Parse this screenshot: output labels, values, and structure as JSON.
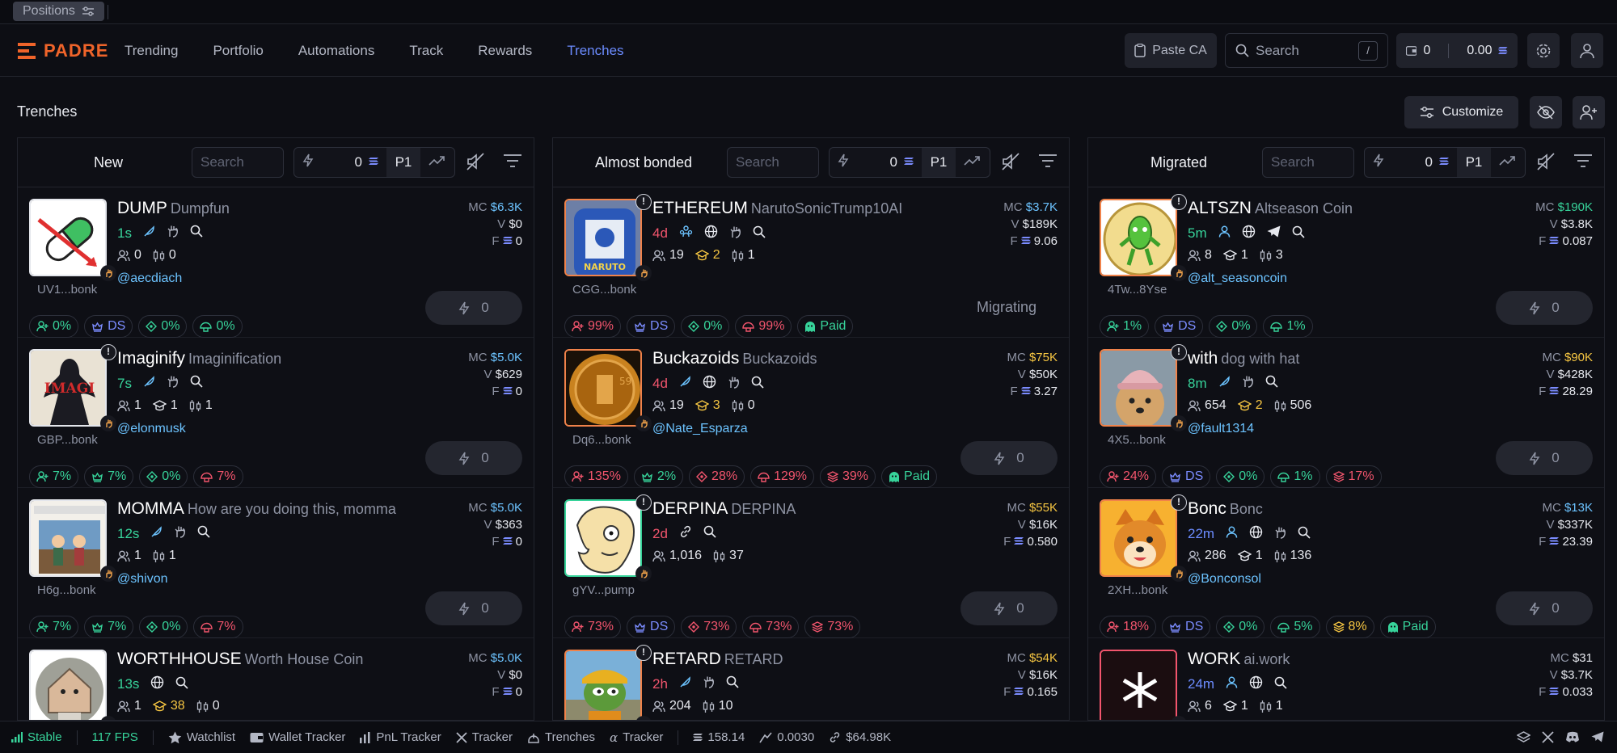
{
  "topstrip": {
    "positions_label": "Positions"
  },
  "nav": {
    "logo": "PADRE",
    "links": [
      "Trending",
      "Portfolio",
      "Automations",
      "Track",
      "Rewards",
      "Trenches"
    ],
    "paste_ca": "Paste CA",
    "search_placeholder": "Search",
    "search_kbd": "/",
    "wallet_count": "0",
    "wallet_balance": "0.00"
  },
  "page": {
    "title": "Trenches",
    "customize": "Customize"
  },
  "columns": [
    {
      "name": "New",
      "search_placeholder": "Search",
      "quick_amount": "0",
      "preset": "P1",
      "cards": [
        {
          "name": "DUMP",
          "sub": "Dumpfun",
          "age": "1s",
          "age_color": "#37d39a",
          "ca": "UV1...bonk",
          "handle": "@aecdiach",
          "mc": "$6.3K",
          "mc_color": "#6cc3ff",
          "v": "$0",
          "f": "0",
          "holders": "0",
          "h2": null,
          "h2c": "w",
          "h3": "0",
          "btn": "0",
          "pills": [
            {
              "t": "0%",
              "c": "g",
              "i": "user"
            },
            {
              "t": "DS",
              "c": "b",
              "i": "hat"
            },
            {
              "t": "0%",
              "c": "g",
              "i": "target"
            },
            {
              "t": "0%",
              "c": "g",
              "i": "mush"
            }
          ],
          "img": "dump",
          "excl": false
        },
        {
          "name": "Imaginify",
          "sub": "Imaginification",
          "age": "7s",
          "age_color": "#37d39a",
          "ca": "GBP...bonk",
          "handle": "@elonmusk",
          "mc": "$5.0K",
          "mc_color": "#6cc3ff",
          "v": "$629",
          "f": "0",
          "holders": "1",
          "h2": "1",
          "h2c": "w",
          "h3": "1",
          "btn": "0",
          "pills": [
            {
              "t": "7%",
              "c": "g",
              "i": "user"
            },
            {
              "t": "7%",
              "c": "g",
              "i": "hat"
            },
            {
              "t": "0%",
              "c": "g",
              "i": "target"
            },
            {
              "t": "7%",
              "c": "r",
              "i": "mush"
            }
          ],
          "img": "imag",
          "excl": true
        },
        {
          "name": "MOMMA",
          "sub": "How are you doing this, momma",
          "age": "12s",
          "age_color": "#37d39a",
          "ca": "H6g...bonk",
          "handle": "@shivon",
          "mc": "$5.0K",
          "mc_color": "#6cc3ff",
          "v": "$363",
          "f": "0",
          "holders": "1",
          "h2": null,
          "h2c": "w",
          "h3": "1",
          "btn": "0",
          "pills": [
            {
              "t": "7%",
              "c": "g",
              "i": "user"
            },
            {
              "t": "7%",
              "c": "g",
              "i": "hat"
            },
            {
              "t": "0%",
              "c": "g",
              "i": "target"
            },
            {
              "t": "7%",
              "c": "r",
              "i": "mush"
            }
          ],
          "img": "momma",
          "excl": false
        },
        {
          "name": "WORTHHOUSE",
          "sub": "Worth House Coin",
          "age": "13s",
          "age_color": "#37d39a",
          "ca": "",
          "handle": "",
          "mc": "$5.0K",
          "mc_color": "#6cc3ff",
          "v": "$0",
          "f": "0",
          "holders": "1",
          "h2": "38",
          "h2c": "y",
          "h3": "0",
          "btn": "0",
          "pills": [],
          "img": "house",
          "excl": false
        }
      ]
    },
    {
      "name": "Almost bonded",
      "search_placeholder": "Search",
      "quick_amount": "0",
      "preset": "P1",
      "cards": [
        {
          "name": "ETHEREUM",
          "sub": "NarutoSonicTrump10AI",
          "age": "4d",
          "age_color": "#f2556d",
          "ca": "CGG...bonk",
          "handle": "",
          "mc": "$3.7K",
          "mc_color": "#6cc3ff",
          "v": "$189K",
          "f": "9.06",
          "holders": "19",
          "h2": "2",
          "h2c": "y",
          "h3": "1",
          "btn": null,
          "migrating": "Migrating",
          "pills": [
            {
              "t": "99%",
              "c": "r",
              "i": "user"
            },
            {
              "t": "DS",
              "c": "b",
              "i": "hat"
            },
            {
              "t": "0%",
              "c": "g",
              "i": "target"
            },
            {
              "t": "99%",
              "c": "r",
              "i": "mush"
            },
            {
              "t": "Paid",
              "c": "g",
              "i": "paid"
            }
          ],
          "img": "naruto",
          "excl": true
        },
        {
          "name": "Buckazoids",
          "sub": "Buckazoids",
          "age": "4d",
          "age_color": "#f2556d",
          "ca": "Dq6...bonk",
          "handle": "@Nate_Esparza",
          "mc": "$75K",
          "mc_color": "#f5c542",
          "v": "$50K",
          "f": "3.27",
          "holders": "19",
          "h2": "3",
          "h2c": "y",
          "h3": "0",
          "btn": "0",
          "pills": [
            {
              "t": "135%",
              "c": "r",
              "i": "user"
            },
            {
              "t": "2%",
              "c": "g",
              "i": "hat"
            },
            {
              "t": "28%",
              "c": "r",
              "i": "target"
            },
            {
              "t": "129%",
              "c": "r",
              "i": "mush"
            },
            {
              "t": "39%",
              "c": "r",
              "i": "stack"
            },
            {
              "t": "Paid",
              "c": "g",
              "i": "paid"
            }
          ],
          "img": "coin",
          "excl": false
        },
        {
          "name": "DERPINA",
          "sub": "DERPINA",
          "age": "2d",
          "age_color": "#f2556d",
          "ca": "gYV...pump",
          "handle": "",
          "mc": "$55K",
          "mc_color": "#f5c542",
          "v": "$16K",
          "f": "0.580",
          "holders": "1,016",
          "h2": null,
          "h2c": "w",
          "h3": "37",
          "btn": "0",
          "pills": [
            {
              "t": "73%",
              "c": "r",
              "i": "user"
            },
            {
              "t": "DS",
              "c": "b",
              "i": "hat"
            },
            {
              "t": "73%",
              "c": "r",
              "i": "target"
            },
            {
              "t": "73%",
              "c": "r",
              "i": "mush"
            },
            {
              "t": "73%",
              "c": "r",
              "i": "stack"
            }
          ],
          "img": "derp",
          "excl": true
        },
        {
          "name": "RETARD",
          "sub": "RETARD",
          "age": "2h",
          "age_color": "#f2556d",
          "ca": "",
          "handle": "",
          "mc": "$54K",
          "mc_color": "#f5c542",
          "v": "$16K",
          "f": "0.165",
          "holders": "204",
          "h2": null,
          "h2c": "w",
          "h3": "10",
          "btn": "0",
          "pills": [],
          "img": "pepe",
          "excl": true
        }
      ]
    },
    {
      "name": "Migrated",
      "search_placeholder": "Search",
      "quick_amount": "0",
      "preset": "P1",
      "cards": [
        {
          "name": "ALTSZN",
          "sub": "Altseason Coin",
          "age": "5m",
          "age_color": "#37d39a",
          "ca": "4Tw...8Yse",
          "handle": "@alt_seasoncoin",
          "mc": "$190K",
          "mc_color": "#37d39a",
          "v": "$3.8K",
          "f": "0.087",
          "holders": "8",
          "h2": "1",
          "h2c": "w",
          "h3": "3",
          "btn": "0",
          "pills": [
            {
              "t": "1%",
              "c": "g",
              "i": "user"
            },
            {
              "t": "DS",
              "c": "b",
              "i": "hat"
            },
            {
              "t": "0%",
              "c": "g",
              "i": "target"
            },
            {
              "t": "1%",
              "c": "g",
              "i": "mush"
            }
          ],
          "img": "alt",
          "excl": true
        },
        {
          "name": "with",
          "sub": "dog with hat",
          "age": "8m",
          "age_color": "#37d39a",
          "ca": "4X5...bonk",
          "handle": "@fault1314",
          "mc": "$90K",
          "mc_color": "#f5c542",
          "v": "$428K",
          "f": "28.29",
          "holders": "654",
          "h2": "2",
          "h2c": "y",
          "h3": "506",
          "btn": "0",
          "pills": [
            {
              "t": "24%",
              "c": "r",
              "i": "user"
            },
            {
              "t": "DS",
              "c": "b",
              "i": "hat"
            },
            {
              "t": "0%",
              "c": "g",
              "i": "target"
            },
            {
              "t": "1%",
              "c": "g",
              "i": "mush"
            },
            {
              "t": "17%",
              "c": "r",
              "i": "stack"
            }
          ],
          "img": "wif",
          "excl": true
        },
        {
          "name": "Bonc",
          "sub": "Bonc",
          "age": "22m",
          "age_color": "#6c8cff",
          "ca": "2XH...bonk",
          "handle": "@Bonconsol",
          "mc": "$13K",
          "mc_color": "#6cc3ff",
          "v": "$337K",
          "f": "23.39",
          "holders": "286",
          "h2": "1",
          "h2c": "w",
          "h3": "136",
          "btn": "0",
          "pills": [
            {
              "t": "18%",
              "c": "r",
              "i": "user"
            },
            {
              "t": "DS",
              "c": "b",
              "i": "hat"
            },
            {
              "t": "0%",
              "c": "g",
              "i": "target"
            },
            {
              "t": "5%",
              "c": "g",
              "i": "mush"
            },
            {
              "t": "8%",
              "c": "y",
              "i": "stack"
            },
            {
              "t": "Paid",
              "c": "g",
              "i": "paid"
            }
          ],
          "img": "bonc",
          "excl": true
        },
        {
          "name": "WORK",
          "sub": "ai.work",
          "age": "24m",
          "age_color": "#6c8cff",
          "ca": "",
          "handle": "",
          "mc": "$31",
          "mc_color": "#e6e8ee",
          "v": "$3.7K",
          "f": "0.033",
          "holders": "6",
          "h2": "1",
          "h2c": "w",
          "h3": "1",
          "btn": "0",
          "pills": [],
          "img": "work",
          "excl": false
        }
      ]
    }
  ],
  "statusbar": {
    "connection": "Stable",
    "fps": "117 FPS",
    "items": [
      "Watchlist",
      "Wallet Tracker",
      "PnL Tracker",
      "Tracker",
      "Trenches",
      "Tracker"
    ],
    "sol_price": "158.14",
    "gas": "0.0030",
    "mcap": "$64.98K"
  },
  "colors": {
    "accent": "#6c8cff",
    "brand": "#f0642a",
    "green": "#37d39a",
    "red": "#f2556d",
    "yellow": "#f5c542"
  }
}
